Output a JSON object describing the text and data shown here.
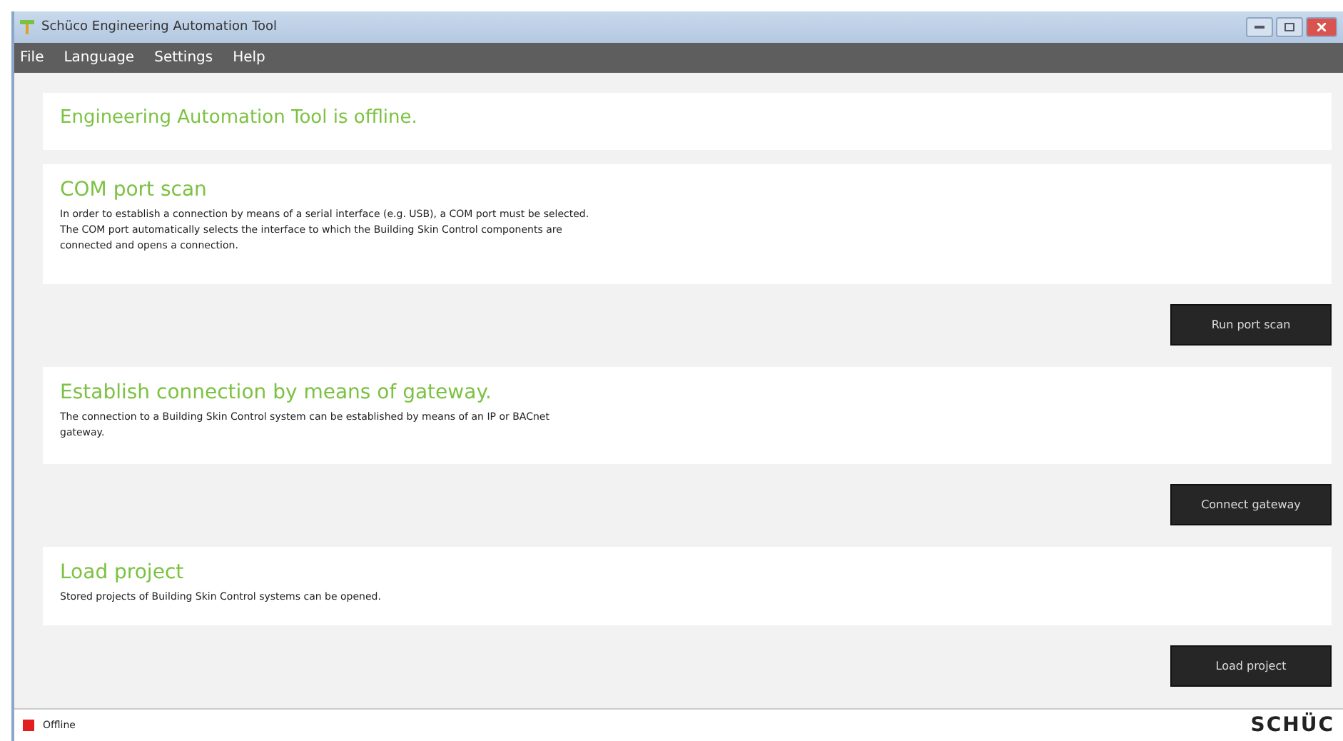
{
  "window": {
    "title": "Schüco Engineering Automation Tool"
  },
  "menu": [
    "File",
    "Language",
    "Settings",
    "Help"
  ],
  "status_panel": {
    "text": "Engineering Automation Tool is offline."
  },
  "sections": [
    {
      "title": "COM port scan",
      "description": "In order to establish a connection by means of a serial interface (e.g. USB), a COM port must be selected.\nThe COM port automatically selects the interface to which the Building Skin Control components are\nconnected and opens a connection.",
      "button": "Run port scan"
    },
    {
      "title": "Establish connection by means of gateway.",
      "description": "The connection to a Building Skin Control system can be established by means of an IP or BACnet\ngateway.",
      "button": "Connect gateway"
    },
    {
      "title": "Load project",
      "description": "Stored projects of Building Skin Control systems can be opened.",
      "button": "Load project"
    }
  ],
  "status_bar": {
    "state": "Offline",
    "color": "#e31e1e",
    "logo": "SCHÜC"
  }
}
